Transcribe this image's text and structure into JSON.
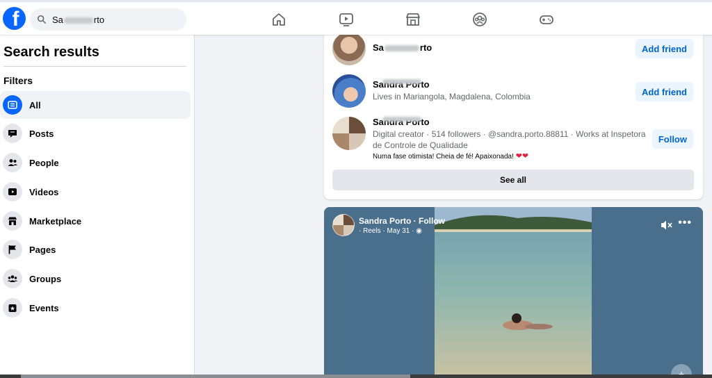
{
  "colors": {
    "brand": "#0866ff",
    "link": "#0064d1",
    "background": "#f0f2f5"
  },
  "header": {
    "logo_letter": "f",
    "search_value_prefix": "Sa",
    "search_value_suffix": "rto"
  },
  "nav_icons": [
    "home-icon",
    "video-icon",
    "marketplace-icon",
    "groups-icon",
    "gaming-icon"
  ],
  "sidebar": {
    "title": "Search results",
    "filters_label": "Filters",
    "items": [
      {
        "label": "All",
        "icon": "feed-icon",
        "active": true
      },
      {
        "label": "Posts",
        "icon": "posts-icon",
        "active": false
      },
      {
        "label": "People",
        "icon": "people-icon",
        "active": false
      },
      {
        "label": "Videos",
        "icon": "videos-icon",
        "active": false
      },
      {
        "label": "Marketplace",
        "icon": "marketplace-icon",
        "active": false
      },
      {
        "label": "Pages",
        "icon": "pages-icon",
        "active": false
      },
      {
        "label": "Groups",
        "icon": "groups-icon",
        "active": false
      },
      {
        "label": "Events",
        "icon": "events-icon",
        "active": false
      }
    ]
  },
  "people": [
    {
      "name_prefix": "Sa",
      "name_suffix": "rto",
      "action": "Add friend"
    },
    {
      "name": "Sandra Porto",
      "description": "Lives in Mariangola, Magdalena, Colombia",
      "action": "Add friend"
    },
    {
      "name": "Sandra Porto",
      "description": "Digital creator · 514 followers · @sandra.porto.88811 · Works at Inspetora de Controle de Qualidade",
      "bio": "Numa fase otimista! Cheia de fé! Apaixonada!",
      "action": "Follow"
    }
  ],
  "see_all_label": "See all",
  "reel": {
    "author": "Sandra Porto · Follow",
    "meta": "· Reels · May 31 · ",
    "more_label": "•••"
  }
}
